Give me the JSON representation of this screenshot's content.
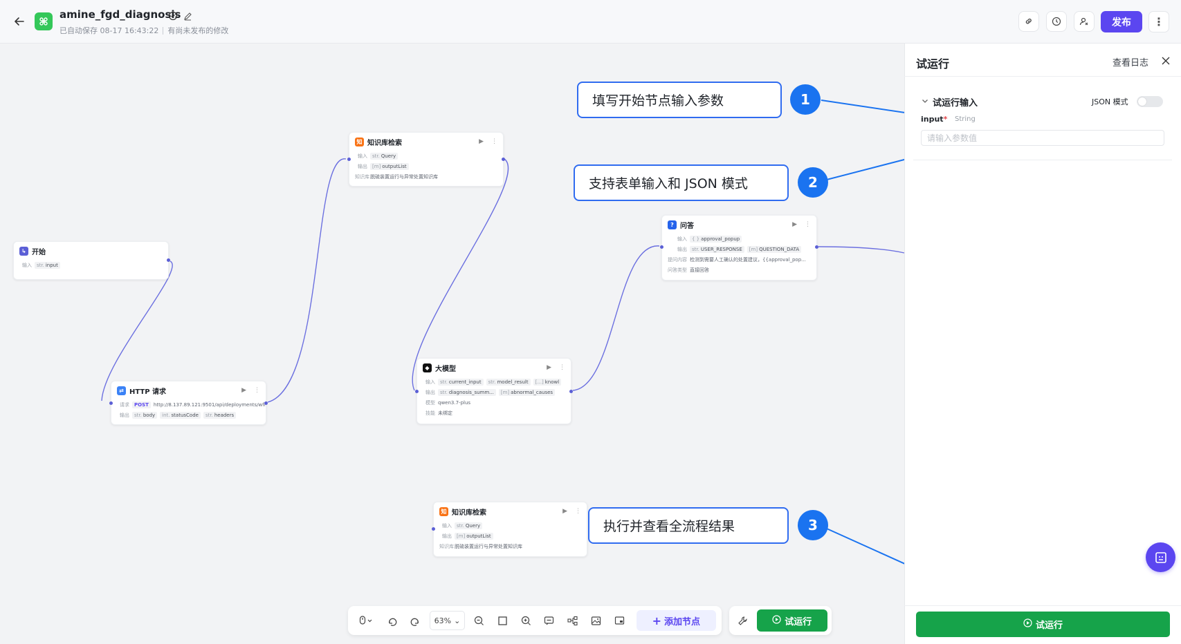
{
  "header": {
    "app_name": "amine_fgd_diagnosis",
    "autosave_text": "已自动保存 08-17 16:43:22",
    "unpublished_text": "有尚未发布的修改",
    "publish_label": "发布"
  },
  "nodes": {
    "start": {
      "title": "开始",
      "input_label": "输入",
      "input_type": "str.",
      "input_name": "input"
    },
    "http": {
      "title": "HTTP 请求",
      "req_label": "请求",
      "method": "POST",
      "url": "http://8.137.89.121:9501/api/deployments/wfr...",
      "out_label": "输出",
      "outputs": [
        {
          "type": "str.",
          "name": "body"
        },
        {
          "type": "int.",
          "name": "statusCode"
        },
        {
          "type": "str.",
          "name": "headers"
        }
      ]
    },
    "kb1": {
      "title": "知识库检索",
      "in_label": "输入",
      "in_type": "str.",
      "in_name": "Query",
      "out_label": "输出",
      "out_type": "[m]",
      "out_name": "outputList",
      "kb_label": "知识库",
      "kb_name": "脱硫装置运行与异常处置知识库"
    },
    "llm": {
      "title": "大模型",
      "in_label": "输入",
      "inputs": [
        {
          "type": "str.",
          "name": "current_input"
        },
        {
          "type": "str.",
          "name": "model_result"
        },
        {
          "type": "[...]",
          "name": "knowl"
        }
      ],
      "out_label": "输出",
      "outputs": [
        {
          "type": "str.",
          "name": "diagnosis_summ..."
        },
        {
          "type": "[m]",
          "name": "abnormal_causes"
        }
      ],
      "model_label": "模型",
      "model_name": "qwen3.7-plus",
      "skill_label": "技能",
      "skill_value": "未绑定"
    },
    "qa": {
      "title": "问答",
      "in_label": "输入",
      "in_type": "{ }",
      "in_name": "approval_popup",
      "out_label": "输出",
      "outputs": [
        {
          "type": "str.",
          "name": "USER_RESPONSE"
        },
        {
          "type": "[m]",
          "name": "QUESTION_DATA"
        }
      ],
      "question_label": "提问内容",
      "question_text": "检测到需要人工确认的处置建议，{{approval_pop...",
      "answer_label": "问答类型",
      "answer_type": "直接回答"
    },
    "kb2": {
      "title": "知识库检索",
      "in_label": "输入",
      "in_type": "str.",
      "in_name": "Query",
      "out_label": "输出",
      "out_type": "[m]",
      "out_name": "outputList",
      "kb_label": "知识库",
      "kb_name": "脱硫装置运行与异常处置知识库"
    }
  },
  "annotations": [
    {
      "step": "1",
      "text": "填写开始节点输入参数"
    },
    {
      "step": "2",
      "text": "支持表单输入和 JSON 模式"
    },
    {
      "step": "3",
      "text": "执行并查看全流程结果"
    }
  ],
  "toolbar": {
    "zoom": "63%",
    "add_node_label": "添加节点",
    "run_label": "试运行"
  },
  "panel": {
    "title": "试运行",
    "log_label": "查看日志",
    "section_title": "试运行输入",
    "json_mode_label": "JSON 模式",
    "field_name": "input",
    "field_required": "*",
    "field_type": "String",
    "field_placeholder": "请输入参数值",
    "run_button_label": "试运行"
  },
  "colors": {
    "accent": "#5b46f0",
    "run_green": "#16a34a",
    "annotation_blue": "#1a73f0",
    "edge": "#6b6fe0"
  }
}
